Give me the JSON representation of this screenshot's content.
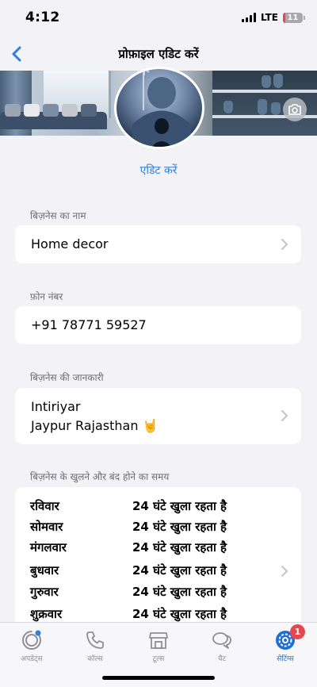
{
  "status_bar": {
    "time": "4:12",
    "network": "LTE",
    "battery": "11",
    "battery_level": 0.11
  },
  "nav": {
    "title": "प्रोफ़ाइल एडिट करें"
  },
  "profile": {
    "edit_label": "एडिट करें"
  },
  "business_name": {
    "label": "बिज़नेस का नाम",
    "value": "Home decor"
  },
  "phone": {
    "label": "फ़ोन नंबर",
    "value": "+91 78771 59527"
  },
  "business_info": {
    "label": "बिज़नेस की जानकारी",
    "line1": "Intiriyar",
    "line2": "Jaypur Rajasthan 🤘"
  },
  "hours": {
    "label": "बिज़नेस के खुलने और बंद होने का समय",
    "rows": [
      {
        "day": "रविवार",
        "value": "24 घंटे खुला रहता है"
      },
      {
        "day": "सोमवार",
        "value": "24 घंटे खुला रहता है"
      },
      {
        "day": "मंगलवार",
        "value": "24 घंटे खुला रहता है"
      },
      {
        "day": "बुधवार",
        "value": "24 घंटे खुला रहता है"
      },
      {
        "day": "गुरुवार",
        "value": "24 घंटे खुला रहता है"
      },
      {
        "day": "शुक्रवार",
        "value": "24 घंटे खुला रहता है"
      }
    ]
  },
  "tabs": [
    {
      "label": "अपडेट्स",
      "icon": "updates-icon"
    },
    {
      "label": "कॉल्स",
      "icon": "phone-icon"
    },
    {
      "label": "टूल्स",
      "icon": "store-icon"
    },
    {
      "label": "चैट",
      "icon": "chat-icon"
    },
    {
      "label": "सेटिंग्स",
      "icon": "settings-icon",
      "badge": "1",
      "active": true
    }
  ],
  "colors": {
    "accent": "#2f7fd6",
    "background": "#f2f2f7",
    "badge": "#e5484d"
  }
}
